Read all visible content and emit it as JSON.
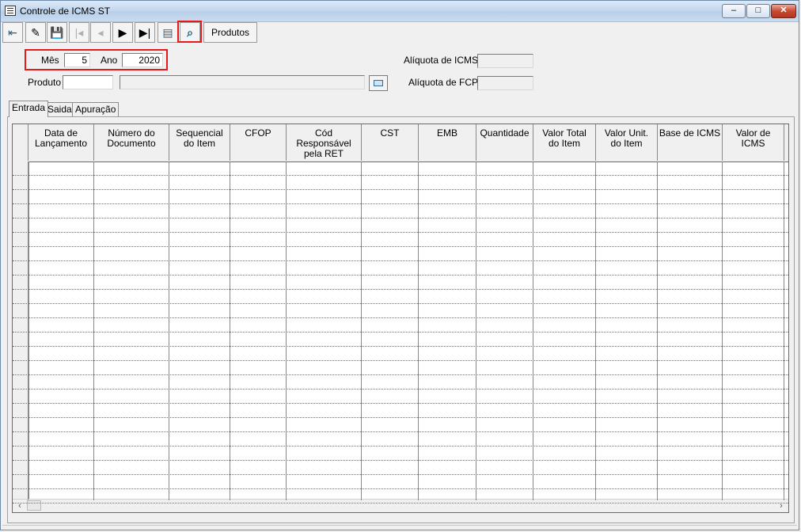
{
  "window": {
    "title": "Controle de ICMS ST",
    "min_label": "‒",
    "max_label": "□",
    "close_label": "✕"
  },
  "toolbar": {
    "buttons": [
      {
        "name": "exit-icon",
        "glyph": "⇤",
        "enabled": true
      },
      {
        "name": "edit-icon",
        "glyph": "✎",
        "enabled": true
      },
      {
        "name": "save-icon",
        "glyph": "💾",
        "enabled": true
      },
      {
        "name": "first-icon",
        "glyph": "|◂",
        "enabled": false
      },
      {
        "name": "prev-icon",
        "glyph": "◂",
        "enabled": false
      },
      {
        "name": "next-icon",
        "glyph": "▶",
        "enabled": true
      },
      {
        "name": "last-icon",
        "glyph": "▶|",
        "enabled": true
      },
      {
        "name": "list-icon",
        "glyph": "▤",
        "enabled": true
      },
      {
        "name": "binoculars-icon",
        "glyph": "⌕",
        "enabled": true
      }
    ],
    "produtos_label": "Produtos"
  },
  "filters": {
    "mes_label": "Mês",
    "mes_value": "5",
    "ano_label": "Ano",
    "ano_value": "2020",
    "produto_label": "Produto",
    "produto_code": "",
    "produto_desc": "",
    "aliquota_icms_label": "Alíquota de ICMS",
    "aliquota_icms_value": "",
    "aliquota_fcp_label": "Alíquota de FCP",
    "aliquota_fcp_value": ""
  },
  "tabs": [
    "Entrada",
    "Saida",
    "Apuração"
  ],
  "table": {
    "columns": [
      "Data de\nLançamento",
      "Número do\nDocumento",
      "Sequencial\ndo Item",
      "CFOP",
      "Cód Responsável\npela RET",
      "CST",
      "EMB",
      "Quantidade",
      "Valor Total\ndo Item",
      "Valor Unit.\ndo Item",
      "Base de ICMS",
      "Valor de ICMS"
    ],
    "row_count": 24
  },
  "colors": {
    "highlight": "#e8191b",
    "titlebar": "#c4d8ee"
  }
}
